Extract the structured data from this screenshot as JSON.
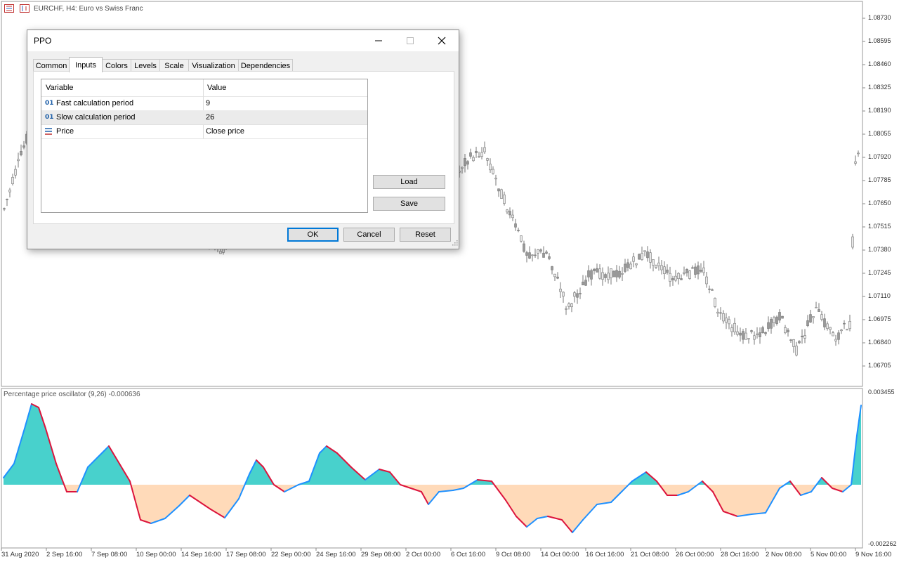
{
  "chart": {
    "title": "EURCHF, H4:  Euro vs Swiss Franc",
    "icons": [
      "chart-bars-icon",
      "chart-window-icon"
    ],
    "indicator_title": "Percentage price oscillator (9,26) -0.000636",
    "price_axis": [
      "1.08730",
      "1.08595",
      "1.08460",
      "1.08325",
      "1.08190",
      "1.08055",
      "1.07920",
      "1.07785",
      "1.07650",
      "1.07515",
      "1.07380",
      "1.07245",
      "1.07110",
      "1.06975",
      "1.06840",
      "1.06705"
    ],
    "indicator_axis": [
      "0.003455",
      "-0.002262"
    ],
    "time_axis": [
      "31 Aug 2020",
      "2 Sep 16:00",
      "7 Sep 08:00",
      "10 Sep 00:00",
      "14 Sep 16:00",
      "17 Sep 08:00",
      "22 Sep 00:00",
      "24 Sep 16:00",
      "29 Sep 08:00",
      "2 Oct 00:00",
      "6 Oct 16:00",
      "9 Oct 08:00",
      "14 Oct 00:00",
      "16 Oct 16:00",
      "21 Oct 08:00",
      "26 Oct 00:00",
      "28 Oct 16:00",
      "2 Nov 08:00",
      "5 Nov 00:00",
      "9 Nov 16:00"
    ],
    "colors": {
      "candle": "#b0b0b0",
      "osc_up": "#1e90ff",
      "osc_down": "#dc143c",
      "fill_pos": "#48d1cc",
      "fill_neg": "#ffdab9"
    }
  },
  "dialog": {
    "title": "PPO",
    "tabs": [
      "Common",
      "Inputs",
      "Colors",
      "Levels",
      "Scale",
      "Visualization",
      "Dependencies"
    ],
    "active_tab": "Inputs",
    "grid": {
      "headers": {
        "variable": "Variable",
        "value": "Value"
      },
      "rows": [
        {
          "icon": "01",
          "variable": "Fast calculation period",
          "value": "9"
        },
        {
          "icon": "01",
          "variable": "Slow calculation period",
          "value": "26"
        },
        {
          "icon": "price-list-icon",
          "variable": "Price",
          "value": "Close price"
        }
      ]
    },
    "buttons": {
      "load": "Load",
      "save": "Save",
      "ok": "OK",
      "cancel": "Cancel",
      "reset": "Reset"
    }
  }
}
